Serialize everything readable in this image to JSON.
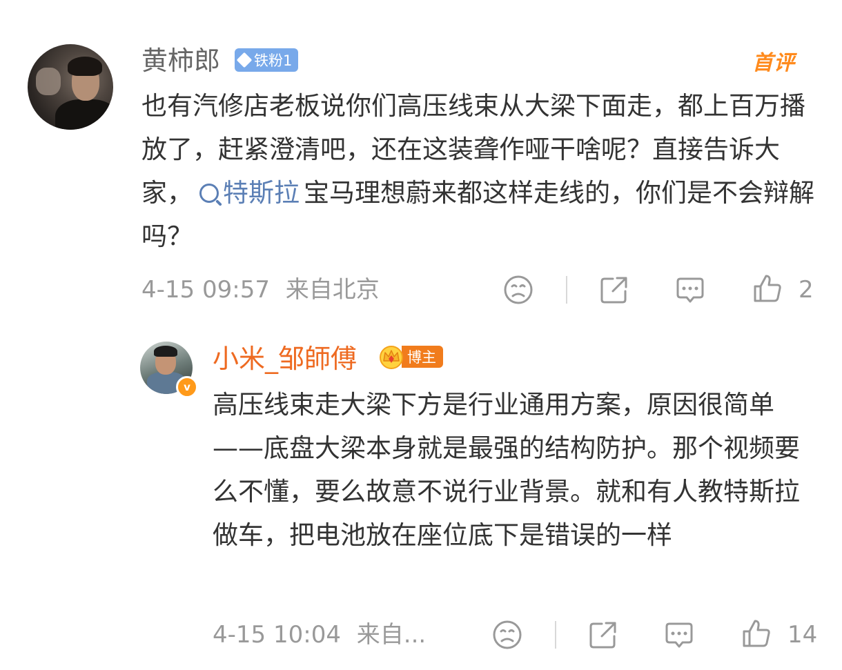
{
  "comment": {
    "username": "黄柿郎",
    "fan_badge": "铁粉1",
    "first_comment_tag": "首评",
    "content_before_topic": "也有汽修店老板说你们高压线束从大梁下面走，都上百万播放了，赶紧澄清吧，还在这装聋作哑干啥呢？直接告诉大家，",
    "topic": "特斯拉",
    "content_after_topic": "宝马理想蔚来都这样走线的，你们是不会辩解吗？",
    "timestamp": "4-15 09:57",
    "location": "来自北京",
    "like_count": "2"
  },
  "reply": {
    "username": "小米_邹師傅",
    "blogger_badge": "博主",
    "verified_mark": "v",
    "content": "高压线束走大梁下方是行业通用方案，原因很简单——底盘大梁本身就是最强的结构防护。那个视频要么不懂，要么故意不说行业背景。就和有人教特斯拉做车，把电池放在座位底下是错误的一样",
    "timestamp": "4-15 10:04",
    "location": "来自...",
    "like_count": "14"
  },
  "colors": {
    "username_main": "#666666",
    "username_reply": "#ee6a21",
    "topic_link": "#5b7fb5",
    "meta_text": "#999999",
    "fan_badge_bg": "#78a9ea",
    "blogger_badge_bg": "#f17c1c",
    "first_comment_tag": "#ff8a1c"
  },
  "icons": [
    "sad-face-icon",
    "share-icon",
    "comment-icon",
    "thumbs-up-icon",
    "search-icon",
    "diamond-icon",
    "crown-icon",
    "verified-icon"
  ]
}
